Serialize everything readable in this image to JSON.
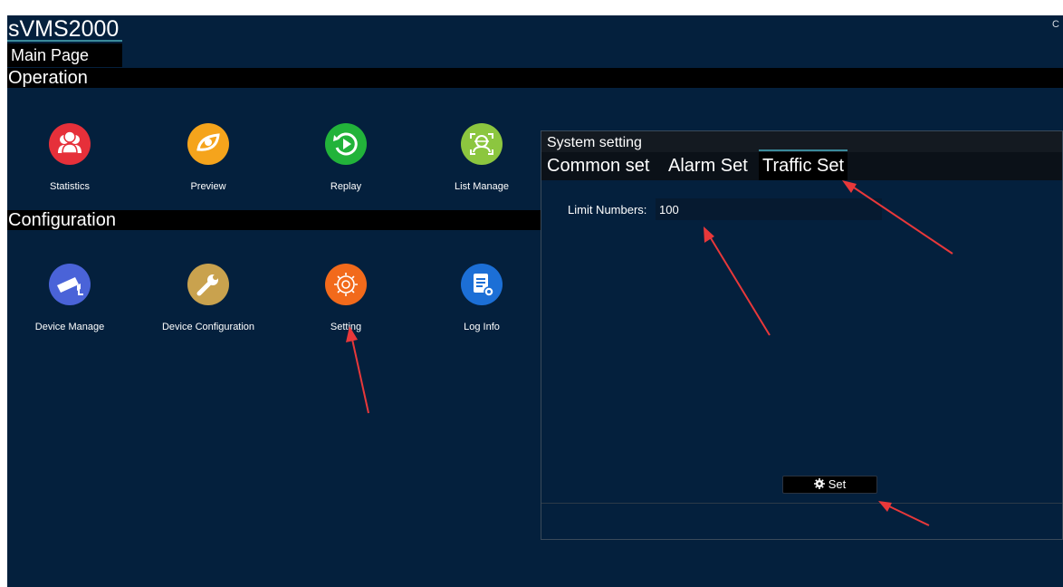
{
  "app": {
    "title": "sVMS2000",
    "corner": "C",
    "main_tab": "Main Page"
  },
  "sections": {
    "operation": "Operation",
    "configuration": "Configuration"
  },
  "operation_tiles": [
    {
      "label": "Statistics",
      "icon": "users-icon",
      "color": "#e6303a"
    },
    {
      "label": "Preview",
      "icon": "eye-icon",
      "color": "#f5a41c"
    },
    {
      "label": "Replay",
      "icon": "replay-icon",
      "color": "#22b33a"
    },
    {
      "label": "List Manage",
      "icon": "face-scan-icon",
      "color": "#8cc63f"
    }
  ],
  "config_tiles": [
    {
      "label": "Device Manage",
      "icon": "camera-icon",
      "color": "#4a63d8"
    },
    {
      "label": "Device Configuration",
      "icon": "wrench-icon",
      "color": "#c9a24e"
    },
    {
      "label": "Setting",
      "icon": "gear-icon",
      "color": "#f26a1b"
    },
    {
      "label": "Log Info",
      "icon": "document-icon",
      "color": "#1c6fd6"
    }
  ],
  "dialog": {
    "title": "System setting",
    "tabs": [
      "Common set",
      "Alarm Set",
      "Traffic Set"
    ],
    "active_tab": "Traffic Set",
    "limit_label": "Limit Numbers:",
    "limit_value": "100",
    "set_label": "Set"
  },
  "annotation_color": "#e8383a"
}
